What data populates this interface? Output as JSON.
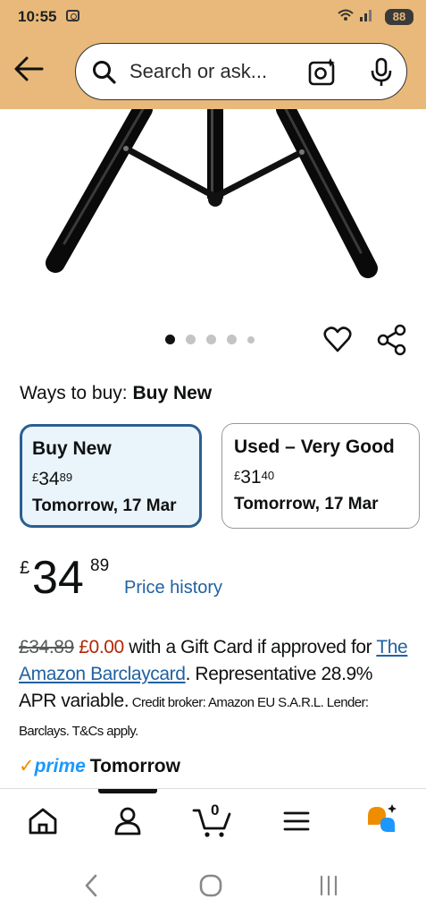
{
  "status_bar": {
    "time": "10:55",
    "signal_text": "᯾ .ıl",
    "battery": "88"
  },
  "header": {
    "search_placeholder": "Search or ask..."
  },
  "carousel": {
    "dot_count": 5,
    "active_index": 0
  },
  "ways_to_buy": {
    "label": "Ways to buy:",
    "selected": "Buy New"
  },
  "options": [
    {
      "title": "Buy New",
      "currency": "£",
      "whole": "34",
      "fraction": "89",
      "delivery": "Tomorrow, 17 Mar",
      "selected": true
    },
    {
      "title": "Used – Very Good",
      "currency": "£",
      "whole": "31",
      "fraction": "40",
      "delivery": "Tomorrow, 17 Mar",
      "selected": false
    }
  ],
  "price": {
    "currency": "£",
    "whole": "34",
    "fraction": "89",
    "history_link": "Price history"
  },
  "promo": {
    "old_price": "£34.89",
    "new_price": "£0.00",
    "text1": " with a Gift Card if approved for ",
    "link": "The Amazon Barclaycard",
    "text2": ". Representative 28.9% APR variable.",
    "small": " Credit broker: Amazon EU S.A.R.L. Lender: Barclays. T&Cs apply."
  },
  "delivery": {
    "prime": "prime",
    "text": "Tomorrow"
  },
  "bottom_nav": {
    "cart_count": "0"
  },
  "colors": {
    "header_bg": "#e8b97a",
    "link": "#2162a1",
    "selected_border": "#2a5f8f",
    "price_red": "#b12704",
    "prime_blue": "#1a98ff"
  }
}
